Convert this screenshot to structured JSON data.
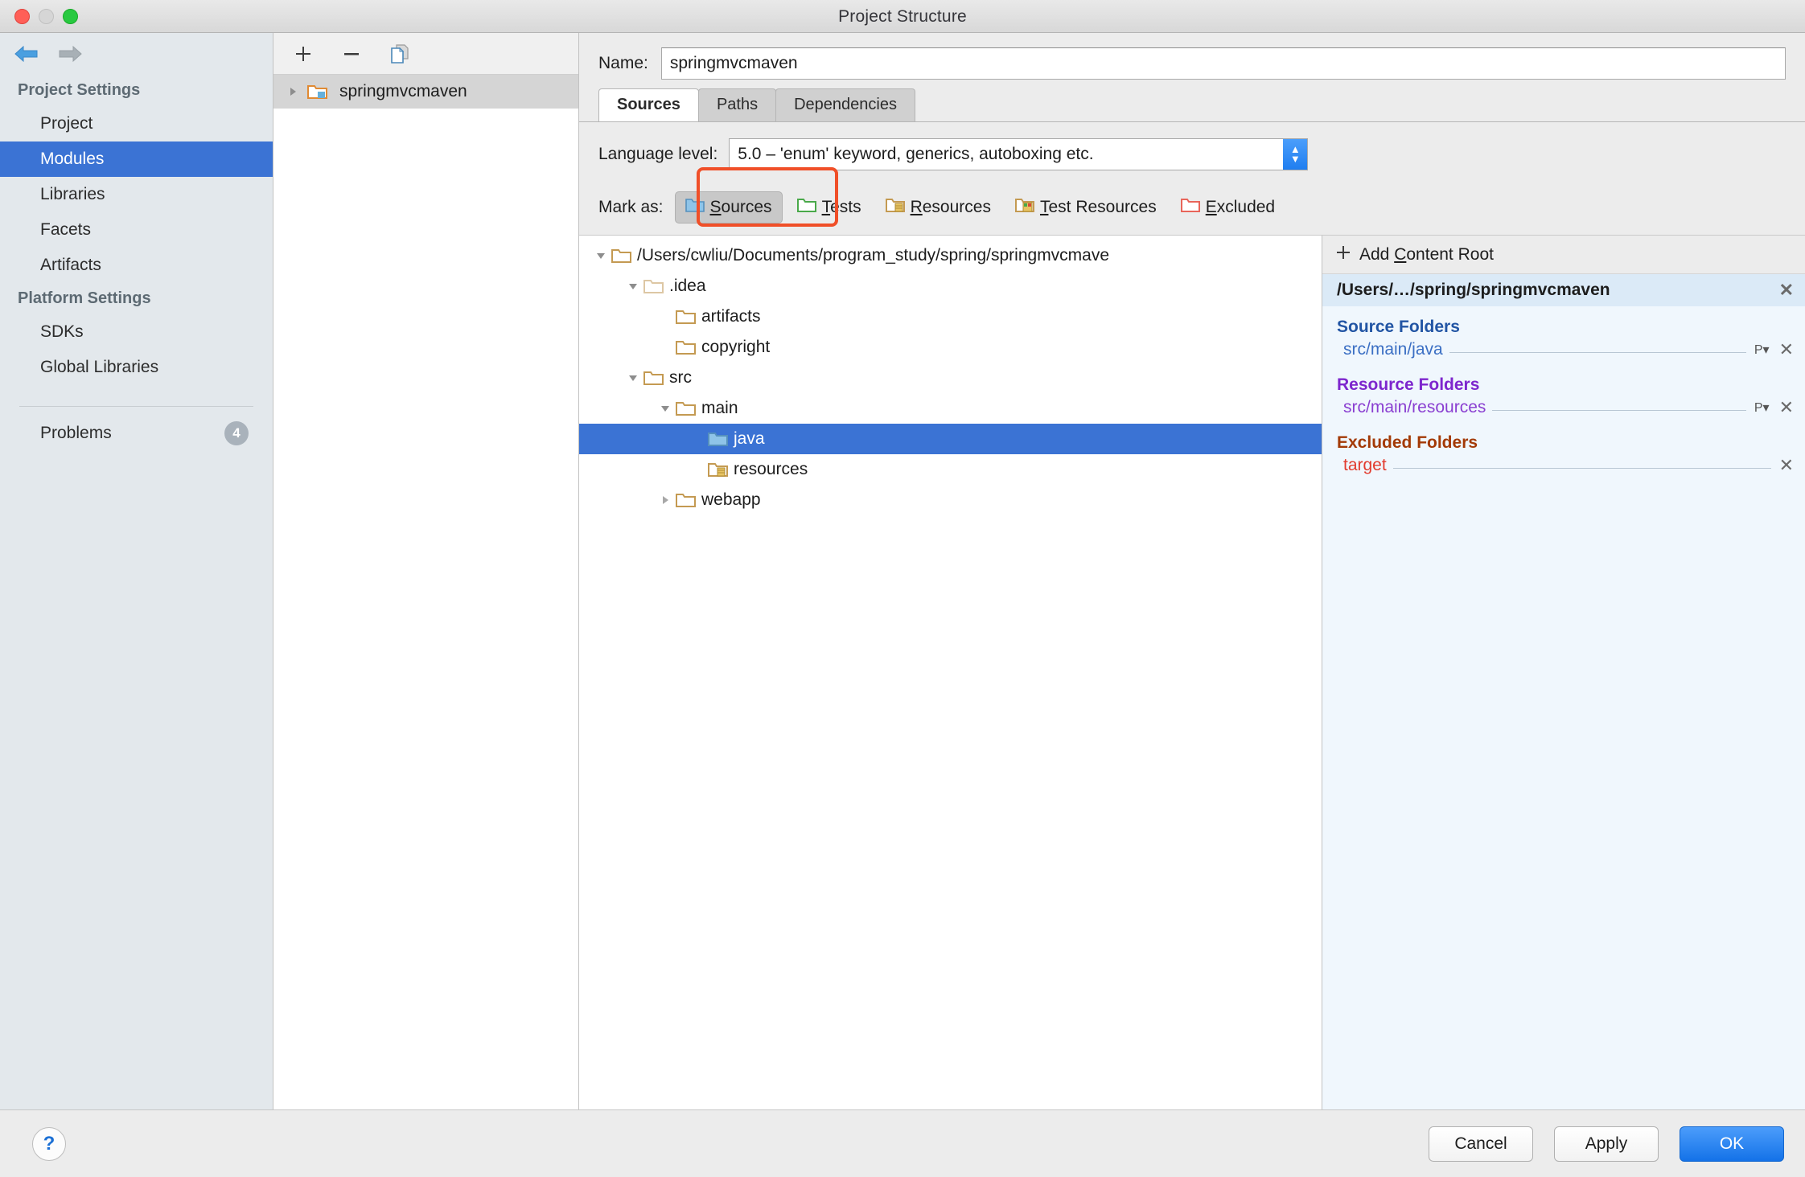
{
  "window": {
    "title": "Project Structure",
    "traffic_lights": [
      "close",
      "minimize",
      "zoom"
    ]
  },
  "sidebar": {
    "nav": {
      "back_icon": "arrow-left-icon",
      "forward_icon": "arrow-right-icon"
    },
    "groups": [
      {
        "label": "Project Settings",
        "items": [
          {
            "label": "Project",
            "selected": false
          },
          {
            "label": "Modules",
            "selected": true
          },
          {
            "label": "Libraries",
            "selected": false
          },
          {
            "label": "Facets",
            "selected": false
          },
          {
            "label": "Artifacts",
            "selected": false
          }
        ]
      },
      {
        "label": "Platform Settings",
        "items": [
          {
            "label": "SDKs",
            "selected": false
          },
          {
            "label": "Global Libraries",
            "selected": false
          }
        ]
      }
    ],
    "problems": {
      "label": "Problems",
      "count": "4"
    }
  },
  "modules_panel": {
    "toolbar": [
      {
        "name": "add-module-button",
        "icon": "plus-icon"
      },
      {
        "name": "remove-module-button",
        "icon": "minus-icon"
      },
      {
        "name": "copy-module-button",
        "icon": "copy-icon"
      }
    ],
    "modules": [
      {
        "label": "springmvcmaven",
        "expanded": false,
        "selected": true
      }
    ]
  },
  "detail": {
    "name_label": "Name:",
    "name_value": "springmvcmaven",
    "tabs": [
      {
        "label": "Sources",
        "active": true
      },
      {
        "label": "Paths",
        "active": false
      },
      {
        "label": "Dependencies",
        "active": false
      }
    ],
    "language_level": {
      "label": "Language level:",
      "value": "5.0 – 'enum' keyword, generics, autoboxing etc.",
      "stepper_up": "▲",
      "stepper_down": "▼"
    },
    "mark_as": {
      "label": "Mark as:",
      "buttons": [
        {
          "label_pre": "",
          "mnemonic": "S",
          "label_post": "ources",
          "icon": "blue-folder-icon",
          "pressed": true,
          "highlighted": true
        },
        {
          "label_pre": "",
          "mnemonic": "T",
          "label_post": "ests",
          "icon": "green-folder-icon",
          "pressed": false,
          "highlighted": false
        },
        {
          "label_pre": "",
          "mnemonic": "R",
          "label_post": "esources",
          "icon": "resource-folder-icon",
          "pressed": false,
          "highlighted": false
        },
        {
          "label_pre": "",
          "mnemonic": "T",
          "label_post": "est Resources",
          "icon": "test-resource-folder-icon",
          "pressed": false,
          "highlighted": false
        },
        {
          "label_pre": "",
          "mnemonic": "E",
          "label_post": "xcluded",
          "icon": "red-folder-icon",
          "pressed": false,
          "highlighted": false
        }
      ]
    },
    "tree": [
      {
        "label": "/Users/cwliu/Documents/program_study/spring/springmvcmave",
        "indent": 0,
        "twisty": "down",
        "icon": "folder-icon",
        "icon_variant": "tan",
        "selected": false
      },
      {
        "label": ".idea",
        "indent": 1,
        "twisty": "down",
        "icon": "folder-icon",
        "icon_variant": "pale",
        "selected": false
      },
      {
        "label": "artifacts",
        "indent": 2,
        "twisty": "none",
        "icon": "folder-icon",
        "icon_variant": "tan",
        "selected": false
      },
      {
        "label": "copyright",
        "indent": 2,
        "twisty": "none",
        "icon": "folder-icon",
        "icon_variant": "tan",
        "selected": false
      },
      {
        "label": "src",
        "indent": 1,
        "twisty": "down",
        "icon": "folder-icon",
        "icon_variant": "tan",
        "selected": false
      },
      {
        "label": "main",
        "indent": 2,
        "twisty": "down",
        "icon": "folder-icon",
        "icon_variant": "tan",
        "selected": false
      },
      {
        "label": "java",
        "indent": 3,
        "twisty": "none",
        "icon": "source-folder-icon",
        "icon_variant": "blue",
        "selected": true
      },
      {
        "label": "resources",
        "indent": 3,
        "twisty": "none",
        "icon": "resource-folder-icon",
        "icon_variant": "resource",
        "selected": false
      },
      {
        "label": "webapp",
        "indent": 2,
        "twisty": "right",
        "icon": "folder-icon",
        "icon_variant": "tan",
        "selected": false
      }
    ]
  },
  "right_panel": {
    "add_content_root": {
      "plus": "+",
      "label_pre": "Add ",
      "mnemonic": "C",
      "label_post": "ontent Root"
    },
    "content_root": {
      "path": "/Users/…/spring/springmvcmaven",
      "remove": "✕"
    },
    "sections": [
      {
        "title": "Source Folders",
        "kind": "source",
        "entries": [
          {
            "path": "src/main/java",
            "prefix_btn": "P",
            "prefix_caret": "▾",
            "remove": "✕"
          }
        ]
      },
      {
        "title": "Resource Folders",
        "kind": "resource",
        "entries": [
          {
            "path": "src/main/resources",
            "prefix_btn": "P",
            "prefix_caret": "▾",
            "remove": "✕"
          }
        ]
      },
      {
        "title": "Excluded Folders",
        "kind": "excluded",
        "entries": [
          {
            "path": "target",
            "prefix_btn": "",
            "prefix_caret": "",
            "remove": "✕"
          }
        ]
      }
    ]
  },
  "footer": {
    "help": "?",
    "buttons": [
      {
        "label": "Cancel",
        "primary": false
      },
      {
        "label": "Apply",
        "primary": false
      },
      {
        "label": "OK",
        "primary": true
      }
    ]
  },
  "colors": {
    "selection_blue": "#3b73d4",
    "accent_highlight": "#f04f28",
    "source_blue": "#2255a4",
    "resource_purple": "#7d26cd",
    "excluded_orange": "#a33a06",
    "excluded_red": "#e23b2e"
  }
}
